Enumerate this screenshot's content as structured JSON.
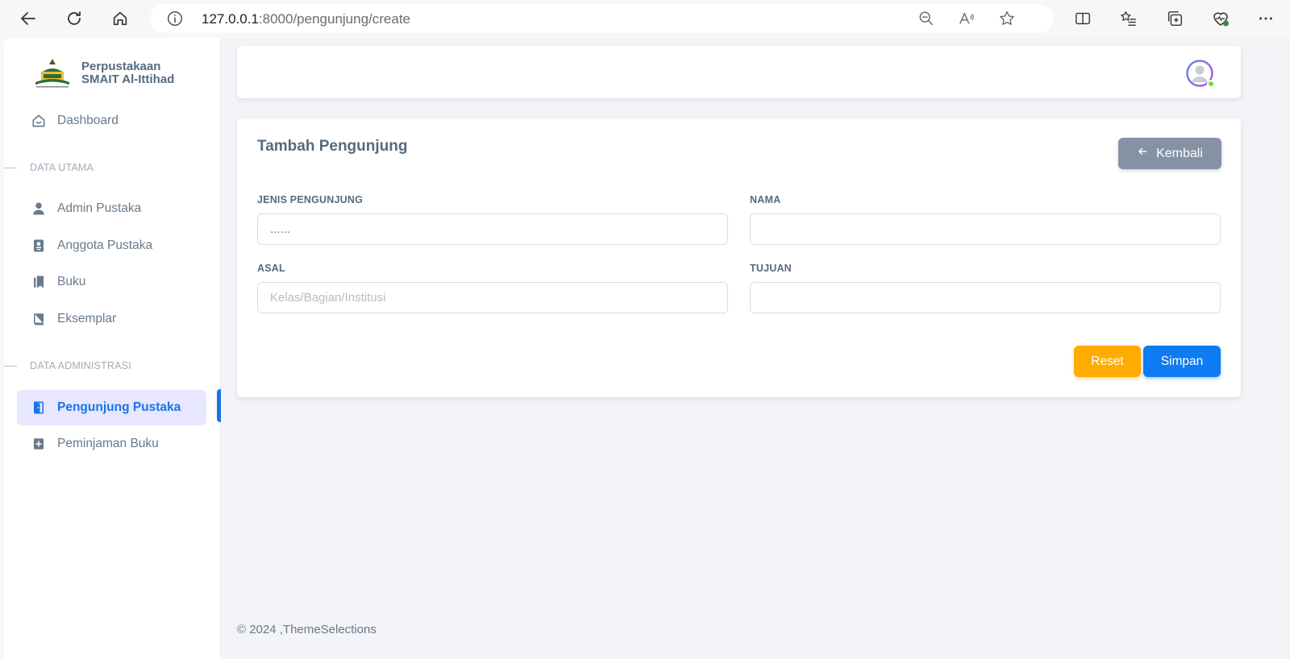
{
  "browser": {
    "url_host": "127.0.0.1",
    "url_path": ":8000/pengunjung/create"
  },
  "sidebar": {
    "brand_line1": "Perpustakaan",
    "brand_line2": "SMAIT Al-Ittihad",
    "dashboard": "Dashboard",
    "section1": "DATA UTAMA",
    "items1": [
      "Admin Pustaka",
      "Anggota Pustaka",
      "Buku",
      "Eksemplar"
    ],
    "section2": "DATA ADMINISTRASI",
    "items2": [
      "Pengunjung Pustaka",
      "Peminjaman Buku"
    ]
  },
  "form": {
    "title": "Tambah Pengunjung",
    "back_label": "Kembali",
    "jenis_label": "JENIS PENGUNJUNG",
    "jenis_value": "......",
    "nama_label": "NAMA",
    "nama_value": "",
    "asal_label": "ASAL",
    "asal_placeholder": "Kelas/Bagian/Institusi",
    "tujuan_label": "TUJUAN",
    "tujuan_value": "",
    "reset_label": "Reset",
    "save_label": "Simpan"
  },
  "footer": {
    "text": "© 2024 ,ThemeSelections"
  },
  "colors": {
    "primary": "#0d7bf2",
    "warning": "#ffab00",
    "secondary": "#8592a3",
    "active_bg": "#e7e7ff"
  }
}
